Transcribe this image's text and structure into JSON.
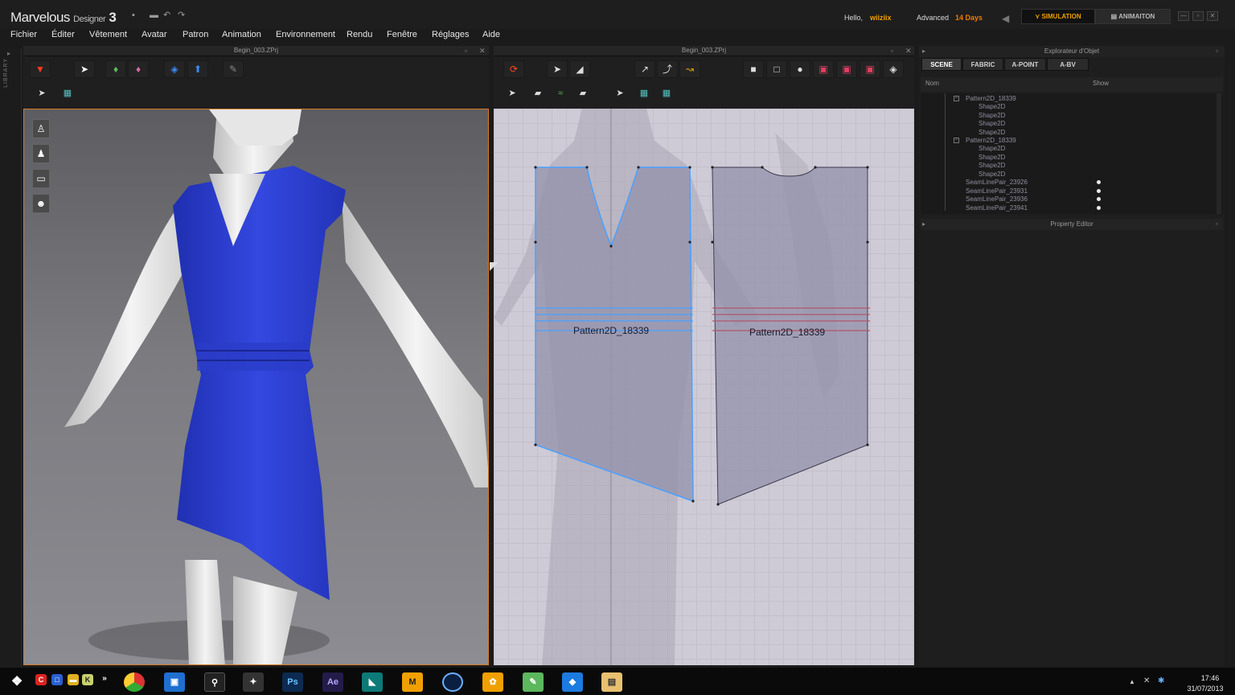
{
  "titlebar": {
    "app_name": "Marvelous",
    "app_name_small": "Designer",
    "app_version": "3",
    "hello_label": "Hello,",
    "user_name": "wiiziix",
    "edition": "Advanced",
    "trial_days": "14 Days",
    "mode_simulation": "SIMULATION",
    "mode_animation": "ANIMAITON"
  },
  "menu": {
    "items": [
      "Fichier",
      "Éditer",
      "Vêtement",
      "Avatar",
      "Patron",
      "Animation",
      "Environnement",
      "Rendu",
      "Fenêtre",
      "Réglages",
      "Aide"
    ]
  },
  "library": {
    "label": "LIBRARY"
  },
  "panel_3d": {
    "title": "Begin_003.ZPrj"
  },
  "panel_2d": {
    "title": "Begin_003.ZPrj",
    "patterns": [
      {
        "label": "Pattern2D_18339",
        "selected": true
      },
      {
        "label": "Pattern2D_18339",
        "selected": false
      }
    ]
  },
  "object_browser": {
    "title": "Explorateur d'Objet",
    "tabs": [
      "SCENE",
      "FABRIC",
      "A-POINT",
      "A-BV"
    ],
    "active_tab": "SCENE",
    "col_name": "Nom",
    "col_show": "Show",
    "tree": [
      {
        "type": "group",
        "label": "Pattern2D_18339",
        "children": [
          "Shape2D",
          "Shape2D",
          "Shape2D",
          "Shape2D"
        ]
      },
      {
        "type": "group",
        "label": "Pattern2D_18339",
        "children": [
          "Shape2D",
          "Shape2D",
          "Shape2D",
          "Shape2D"
        ]
      },
      {
        "type": "item",
        "label": "SeamLinePair_23926",
        "show": true
      },
      {
        "type": "item",
        "label": "SeamLinePair_23931",
        "show": true
      },
      {
        "type": "item",
        "label": "SeamLinePair_23936",
        "show": true
      },
      {
        "type": "item",
        "label": "SeamLinePair_23941",
        "show": true
      }
    ]
  },
  "property_editor": {
    "title": "Property Editor"
  },
  "taskbar": {
    "apps": [
      "start-orb",
      "chrome",
      "save",
      "mouse",
      "zbrush",
      "Ps",
      "Ae",
      "maya",
      "M",
      "cinema4d",
      "pinwheel",
      "evernote",
      "dropbox",
      "explorer"
    ],
    "time": "17:46",
    "date": "31/07/2013"
  },
  "colors": {
    "accent_orange": "#f0a000",
    "dress_blue": "#2c3fd0",
    "viewport_border": "#d37a28",
    "pattern_fill": "#9d9ab3",
    "selection_blue": "#4aa0ff"
  }
}
